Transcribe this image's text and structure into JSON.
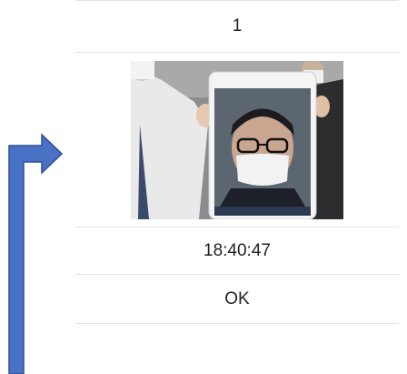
{
  "record": {
    "id_value": "1",
    "time_value": "18:40:47",
    "status_value": "OK"
  },
  "photo": {
    "description_icon": "face-photo-icon"
  },
  "colors": {
    "arrow": "#4a72c4",
    "arrow_stroke": "#2d4f98",
    "divider": "#e4e4e4"
  }
}
